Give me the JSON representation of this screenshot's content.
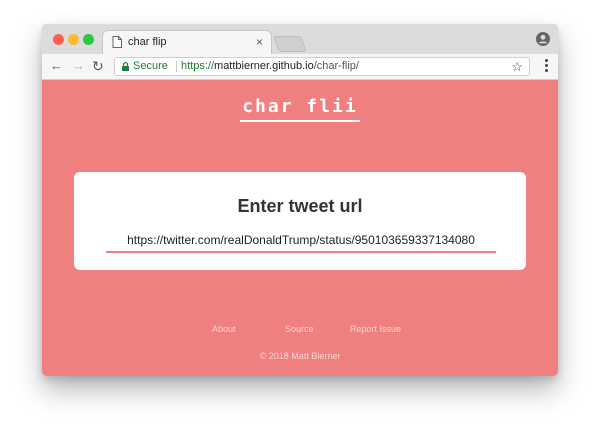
{
  "browser": {
    "tab_title": "char flip",
    "secure_label": "Secure",
    "url_scheme": "https://",
    "url_host": "mattbierner.github.io",
    "url_path": "/char-flip/"
  },
  "page": {
    "logo": "char flii",
    "card_title": "Enter tweet url",
    "tweet_url": "https://twitter.com/realDonaldTrump/status/950103659337134080",
    "footer_links": [
      "About",
      "Source",
      "Report Issue"
    ],
    "copyright": "© 2018 Matt Bierner"
  },
  "colors": {
    "accent": "#f08080",
    "secure_green": "#1e7e34"
  },
  "icons": [
    "document-icon",
    "close-icon",
    "profile-icon",
    "back-arrow-icon",
    "forward-arrow-icon",
    "reload-icon",
    "lock-icon",
    "star-icon",
    "menu-icon"
  ]
}
